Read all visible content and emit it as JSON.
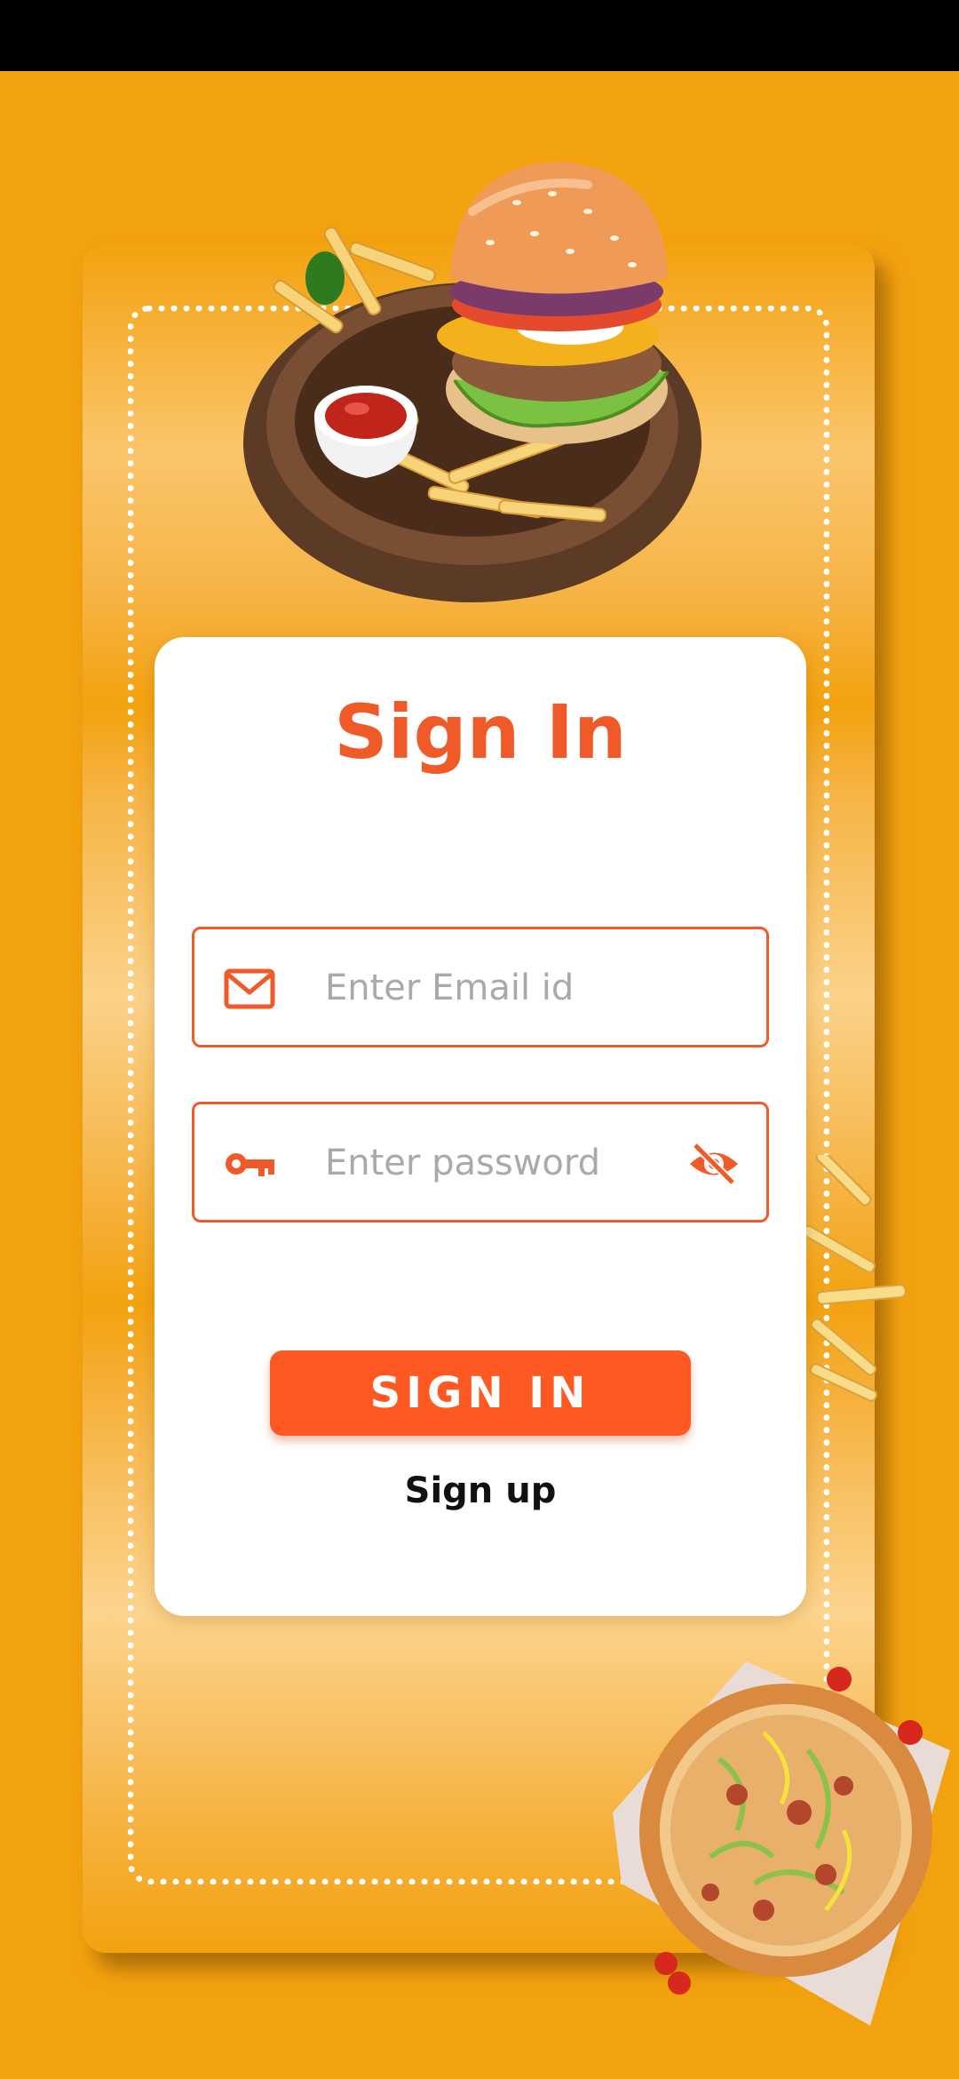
{
  "signin": {
    "title": "Sign In",
    "email_placeholder": "Enter Email id",
    "password_placeholder": "Enter password",
    "signin_button": "SIGN IN",
    "signup_link": "Sign up"
  },
  "icons": {
    "email": "mail-icon",
    "password": "key-icon",
    "visibility": "eye-off-icon"
  },
  "colors": {
    "background": "#f3a20f",
    "accent": "#f05a28",
    "button": "#fe5923",
    "card": "#ffffff"
  }
}
